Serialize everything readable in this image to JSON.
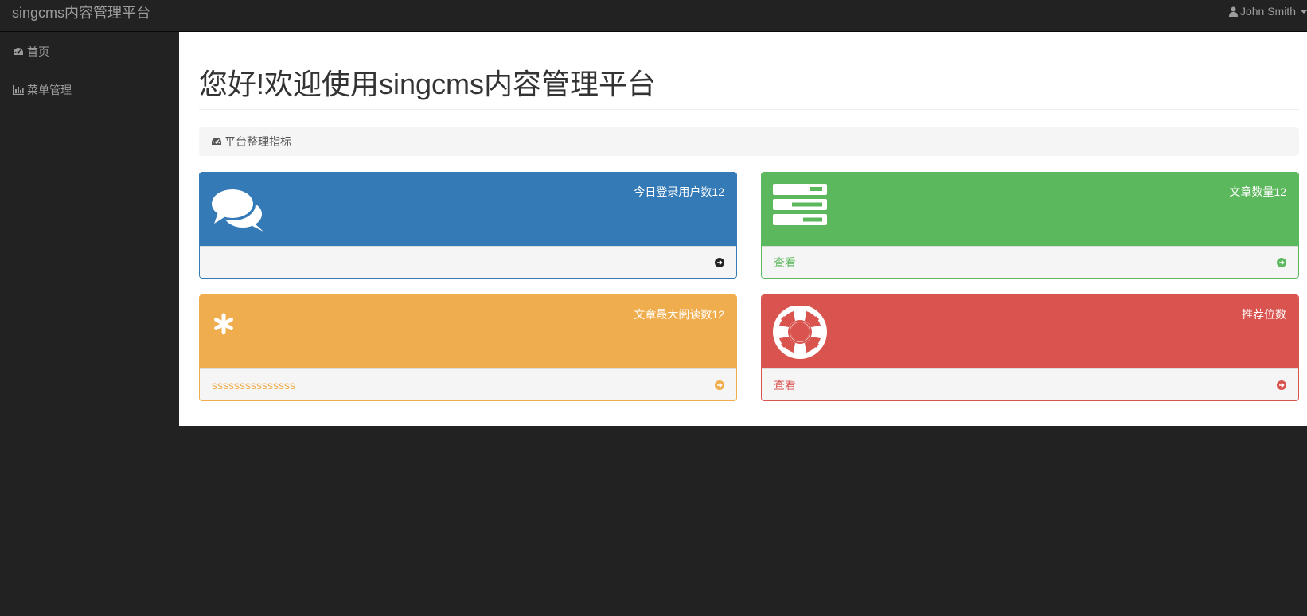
{
  "navbar": {
    "brand": "singcms内容管理平台",
    "user_name": "John Smith"
  },
  "sidebar": {
    "items": [
      {
        "label": "首页",
        "icon": "dashboard-icon"
      },
      {
        "label": "菜单管理",
        "icon": "bar-chart-icon"
      }
    ]
  },
  "main": {
    "title": "您好!欢迎使用singcms内容管理平台",
    "breadcrumb": "平台整理指标",
    "panels": [
      {
        "metric": "今日登录用户数12",
        "footer_text": "",
        "icon": "comments-icon",
        "color": "#337ab7"
      },
      {
        "metric": "文章数量12",
        "footer_text": "查看",
        "icon": "tasks-icon",
        "color": "#5cb85c"
      },
      {
        "metric": "文章最大阅读数12",
        "footer_text": "sssssssssssssss",
        "icon": "asterisk-icon",
        "color": "#f0ad4e"
      },
      {
        "metric": "推荐位数",
        "footer_text": "查看",
        "icon": "life-ring-icon",
        "color": "#d9534f"
      }
    ]
  },
  "colors": {
    "background": "#222222",
    "nav_text": "#9d9d9d",
    "primary": "#337ab7",
    "success": "#5cb85c",
    "warning": "#f0ad4e",
    "danger": "#d9534f"
  }
}
